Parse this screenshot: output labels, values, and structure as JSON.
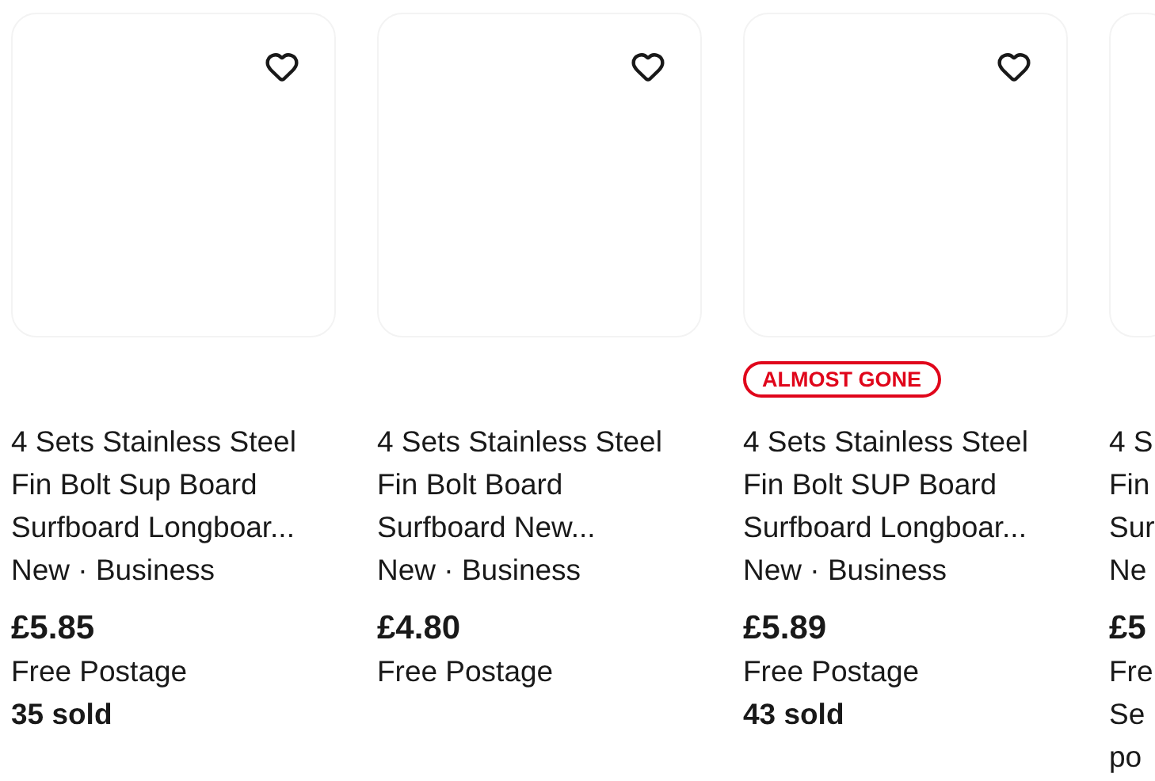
{
  "cards": [
    {
      "favorite": false,
      "title_lines": [
        "4 Sets Stainless Steel",
        "Fin Bolt Sup Board",
        "Surfboard Longboar..."
      ],
      "condition": "New · Business",
      "price": "£5.85",
      "postage": "Free Postage",
      "sold": "35 sold"
    },
    {
      "favorite": false,
      "title_lines": [
        "4 Sets Stainless Steel",
        "Fin Bolt Board",
        "Surfboard New..."
      ],
      "condition": "New · Business",
      "price": "£4.80",
      "postage": "Free Postage"
    },
    {
      "favorite": false,
      "badge": "ALMOST GONE",
      "title_lines": [
        "4 Sets Stainless Steel",
        "Fin Bolt SUP Board",
        "Surfboard Longboar..."
      ],
      "condition": "New · Business",
      "price": "£5.89",
      "postage": "Free Postage",
      "sold": "43 sold"
    },
    {
      "title_lines": [
        "4 S",
        "Fin",
        "Sur"
      ],
      "condition": "Ne",
      "price": "£5",
      "postage": "Fre",
      "note_lines": [
        "Se",
        "po"
      ]
    }
  ]
}
